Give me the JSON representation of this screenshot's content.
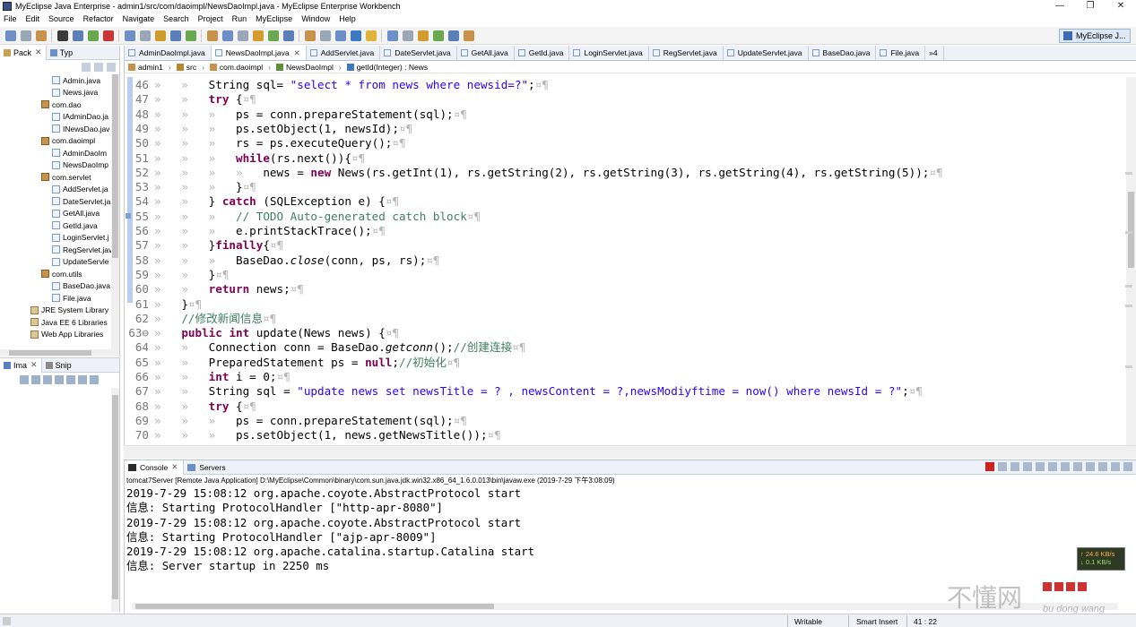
{
  "window": {
    "title": "MyEclipse Java Enterprise - admin1/src/com/daoimpl/NewsDaoImpl.java - MyEclipse Enterprise Workbench",
    "min": "—",
    "max": "❐",
    "close": "✕"
  },
  "menu": [
    "File",
    "Edit",
    "Source",
    "Refactor",
    "Navigate",
    "Search",
    "Project",
    "Run",
    "MyEclipse",
    "Window",
    "Help"
  ],
  "perspective": {
    "label": "MyEclipse J..."
  },
  "left_panel": {
    "tabs": [
      {
        "label": "Pack",
        "close": "✕"
      },
      {
        "label": "Typ"
      }
    ],
    "tree": [
      {
        "label": "Admin.java",
        "kind": "file",
        "indent": 58
      },
      {
        "label": "News.java",
        "kind": "file",
        "indent": 58
      },
      {
        "label": "com.dao",
        "kind": "pkg",
        "indent": 46
      },
      {
        "label": "IAdminDao.ja",
        "kind": "file",
        "indent": 58
      },
      {
        "label": "INewsDao.jav",
        "kind": "file",
        "indent": 58
      },
      {
        "label": "com.daoimpl",
        "kind": "pkg",
        "indent": 46
      },
      {
        "label": "AdminDaoIm",
        "kind": "file",
        "indent": 58
      },
      {
        "label": "NewsDaoImp",
        "kind": "file",
        "indent": 58
      },
      {
        "label": "com.servlet",
        "kind": "pkg",
        "indent": 46
      },
      {
        "label": "AddServlet.ja",
        "kind": "file",
        "indent": 58
      },
      {
        "label": "DateServlet.ja",
        "kind": "file",
        "indent": 58
      },
      {
        "label": "GetAll.java",
        "kind": "file",
        "indent": 58
      },
      {
        "label": "GetId.java",
        "kind": "file",
        "indent": 58
      },
      {
        "label": "LoginServlet.j",
        "kind": "file",
        "indent": 58
      },
      {
        "label": "RegServlet.jav",
        "kind": "file",
        "indent": 58
      },
      {
        "label": "UpdateServle",
        "kind": "file",
        "indent": 58
      },
      {
        "label": "com.utils",
        "kind": "pkg",
        "indent": 46
      },
      {
        "label": "BaseDao.java",
        "kind": "file",
        "indent": 58
      },
      {
        "label": "File.java",
        "kind": "file",
        "indent": 58
      },
      {
        "label": "JRE System Library",
        "kind": "lib",
        "indent": 34
      },
      {
        "label": "Java EE 6 Libraries",
        "kind": "lib",
        "indent": 34
      },
      {
        "label": "Web App Libraries",
        "kind": "lib",
        "indent": 34
      }
    ]
  },
  "left_lower": {
    "tabs": [
      {
        "label": "Ima",
        "close": "✕"
      },
      {
        "label": "Snip"
      }
    ]
  },
  "editor": {
    "tabs": [
      {
        "label": "AdminDaoImpl.java",
        "active": false
      },
      {
        "label": "NewsDaoImpl.java",
        "active": true,
        "close": "✕"
      },
      {
        "label": "AddServlet.java",
        "active": false
      },
      {
        "label": "DateServlet.java",
        "active": false
      },
      {
        "label": "GetAll.java",
        "active": false
      },
      {
        "label": "GetId.java",
        "active": false
      },
      {
        "label": "LoginServlet.java",
        "active": false
      },
      {
        "label": "RegServlet.java",
        "active": false
      },
      {
        "label": "UpdateServlet.java",
        "active": false
      },
      {
        "label": "BaseDao.java",
        "active": false
      },
      {
        "label": "File.java",
        "active": false
      },
      {
        "label": "»4",
        "active": false
      }
    ],
    "breadcrumb": [
      "admin1",
      "src",
      "com.daoimpl",
      "NewsDaoImpl",
      "getId(Integer) : News"
    ],
    "lines": [
      {
        "n": "46",
        "ind": "»   »   ",
        "seg": [
          [
            "t",
            "String sql= "
          ],
          [
            "s",
            "\"select * from news where newsid=?\""
          ],
          [
            "t",
            ";"
          ]
        ]
      },
      {
        "n": "47",
        "ind": "»   »   ",
        "seg": [
          [
            "k",
            "try"
          ],
          [
            "t",
            " {"
          ]
        ]
      },
      {
        "n": "48",
        "ind": "»   »   »   ",
        "seg": [
          [
            "t",
            "ps = conn.prepareStatement(sql);"
          ]
        ]
      },
      {
        "n": "49",
        "ind": "»   »   »   ",
        "seg": [
          [
            "t",
            "ps.setObject(1, newsId);"
          ]
        ]
      },
      {
        "n": "50",
        "ind": "»   »   »   ",
        "seg": [
          [
            "t",
            "rs = ps.executeQuery();"
          ]
        ]
      },
      {
        "n": "51",
        "ind": "»   »   »   ",
        "seg": [
          [
            "k",
            "while"
          ],
          [
            "t",
            "(rs.next()){"
          ]
        ]
      },
      {
        "n": "52",
        "ind": "»   »   »   »   ",
        "seg": [
          [
            "t",
            "news = "
          ],
          [
            "k",
            "new"
          ],
          [
            "t",
            " News(rs.getInt(1), rs.getString(2), rs.getString(3), rs.getString(4), rs.getString(5));"
          ]
        ]
      },
      {
        "n": "53",
        "ind": "»   »   »   ",
        "seg": [
          [
            "t",
            "}"
          ]
        ]
      },
      {
        "n": "54",
        "ind": "»   »   ",
        "seg": [
          [
            "t",
            "} "
          ],
          [
            "k",
            "catch"
          ],
          [
            "t",
            " (SQLException e) {"
          ]
        ]
      },
      {
        "n": "55",
        "ind": "»   »   »   ",
        "seg": [
          [
            "c",
            "// TODO Auto-generated catch block"
          ]
        ]
      },
      {
        "n": "56",
        "ind": "»   »   »   ",
        "seg": [
          [
            "t",
            "e.printStackTrace();"
          ]
        ]
      },
      {
        "n": "57",
        "ind": "»   »   ",
        "seg": [
          [
            "t",
            "}"
          ],
          [
            "k",
            "finally"
          ],
          [
            "t",
            "{"
          ]
        ]
      },
      {
        "n": "58",
        "ind": "»   »   »   ",
        "seg": [
          [
            "t",
            "BaseDao."
          ],
          [
            "i",
            "close"
          ],
          [
            "t",
            "(conn, ps, rs);"
          ]
        ]
      },
      {
        "n": "59",
        "ind": "»   »   ",
        "seg": [
          [
            "t",
            "}"
          ]
        ]
      },
      {
        "n": "60",
        "ind": "»   »   ",
        "seg": [
          [
            "k",
            "return"
          ],
          [
            "t",
            " news;"
          ]
        ]
      },
      {
        "n": "61",
        "ind": "»   ",
        "seg": [
          [
            "t",
            "}"
          ]
        ]
      },
      {
        "n": "62",
        "ind": "»   ",
        "seg": [
          [
            "c",
            "//修改新闻信息"
          ]
        ]
      },
      {
        "n": "63⊖",
        "ind": "»   ",
        "seg": [
          [
            "k",
            "public"
          ],
          [
            "t",
            " "
          ],
          [
            "k",
            "int"
          ],
          [
            "t",
            " update(News news) {"
          ]
        ]
      },
      {
        "n": "64",
        "ind": "»   »   ",
        "seg": [
          [
            "t",
            "Connection conn = BaseDao."
          ],
          [
            "i",
            "getconn"
          ],
          [
            "t",
            "();"
          ],
          [
            "c",
            "//创建连接"
          ]
        ]
      },
      {
        "n": "65",
        "ind": "»   »   ",
        "seg": [
          [
            "t",
            "PreparedStatement ps = "
          ],
          [
            "k",
            "null"
          ],
          [
            "t",
            ";"
          ],
          [
            "c",
            "//初始化"
          ]
        ]
      },
      {
        "n": "66",
        "ind": "»   »   ",
        "seg": [
          [
            "k",
            "int"
          ],
          [
            "t",
            " i = 0;"
          ]
        ]
      },
      {
        "n": "67",
        "ind": "»   »   ",
        "seg": [
          [
            "t",
            "String sql = "
          ],
          [
            "s",
            "\"update news set newsTitle = ? , newsContent = ?,newsModiyftime = now() where newsId = ?\""
          ],
          [
            "t",
            ";"
          ]
        ]
      },
      {
        "n": "68",
        "ind": "»   »   ",
        "seg": [
          [
            "k",
            "try"
          ],
          [
            "t",
            " {"
          ]
        ]
      },
      {
        "n": "69",
        "ind": "»   »   »   ",
        "seg": [
          [
            "t",
            "ps = conn.prepareStatement(sql);"
          ]
        ]
      },
      {
        "n": "70",
        "ind": "»   »   »   ",
        "seg": [
          [
            "t",
            "ps.setObject(1, news.getNewsTitle());"
          ]
        ]
      }
    ]
  },
  "console": {
    "tabs": [
      {
        "label": "Console",
        "close": "✕"
      },
      {
        "label": "Servers"
      }
    ],
    "info": "tomcat7Server [Remote Java Application] D:\\MyEclipse\\Common\\binary\\com.sun.java.jdk.win32.x86_64_1.6.0.013\\bin\\javaw.exe (2019-7-29 下午3:08:09)",
    "lines": [
      "2019-7-29 15:08:12 org.apache.coyote.AbstractProtocol start",
      "信息: Starting ProtocolHandler [\"http-apr-8080\"]",
      "2019-7-29 15:08:12 org.apache.coyote.AbstractProtocol start",
      "信息: Starting ProtocolHandler [\"ajp-apr-8009\"]",
      "2019-7-29 15:08:12 org.apache.catalina.startup.Catalina start",
      "信息: Server startup in 2250 ms"
    ]
  },
  "network": {
    "up": "↑ 24.6 KB/s",
    "down": "↓ 0.1 KB/s"
  },
  "watermark": {
    "cn": "不懂网",
    "en": "bu dong wang"
  },
  "status": {
    "mode": "Writable",
    "insert": "Smart Insert",
    "position": "41 : 22"
  },
  "colors": {
    "keyword": "#7f0055",
    "string": "#2a00ff",
    "comment": "#3f7f5f"
  }
}
